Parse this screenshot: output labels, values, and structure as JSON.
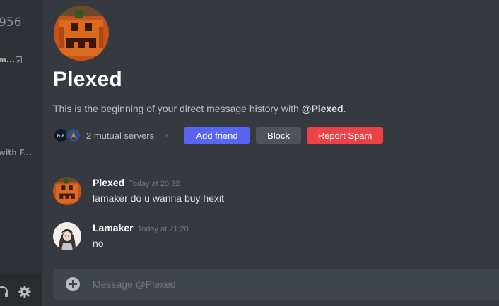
{
  "sidebar": {
    "partial_number": "956",
    "item1_label": "m...",
    "item2_label": "with F...",
    "doc_icon": "document-icon",
    "headphones_icon": "headphones-icon",
    "settings_icon": "gear-icon"
  },
  "profile": {
    "name": "Plexed",
    "description_prefix": "This is the beginning of your direct message history with ",
    "description_mention": "@Plexed",
    "description_suffix": ".",
    "mutual_servers_text": "2 mutual servers",
    "mutual_server_icon_label": "Fo8",
    "buttons": {
      "add_friend": "Add friend",
      "block": "Block",
      "report_spam": "Report Spam"
    }
  },
  "messages": [
    {
      "author": "Plexed",
      "timestamp": "Today at 20:32",
      "text": "lamaker do u wanna buy hexit"
    },
    {
      "author": "Lamaker",
      "timestamp": "Today at 21:20",
      "text": "no"
    }
  ],
  "composer": {
    "placeholder": "Message @Plexed"
  },
  "colors": {
    "background": "#36393f",
    "sidebar": "#2f3136",
    "blurple": "#5865f2",
    "red": "#ed4245",
    "grey_button": "#4f545c"
  }
}
